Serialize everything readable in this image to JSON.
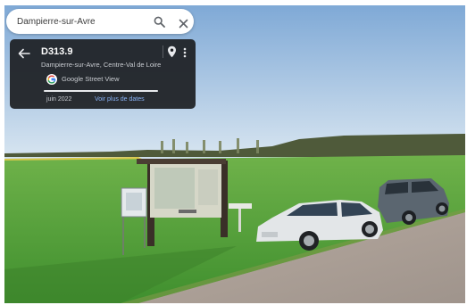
{
  "search": {
    "value": "Dampierre-sur-Avre",
    "search_icon": "search-icon",
    "close_icon": "close-icon"
  },
  "info_card": {
    "title": "D313.9",
    "subtitle": "Dampierre-sur-Avre, Centre-Val de Loire",
    "source": "Google Street View",
    "date": "juin 2022",
    "more_dates": "Voir plus de dates",
    "timeline_position": 1.0,
    "icons": [
      "back-arrow-icon",
      "location-pin-icon",
      "more-vert-icon",
      "google-logo-icon"
    ]
  },
  "colors": {
    "card_bg": "#1c1e22",
    "link": "#8ab4f8",
    "sky": "#a9c8e6",
    "field": "#55a13f"
  }
}
